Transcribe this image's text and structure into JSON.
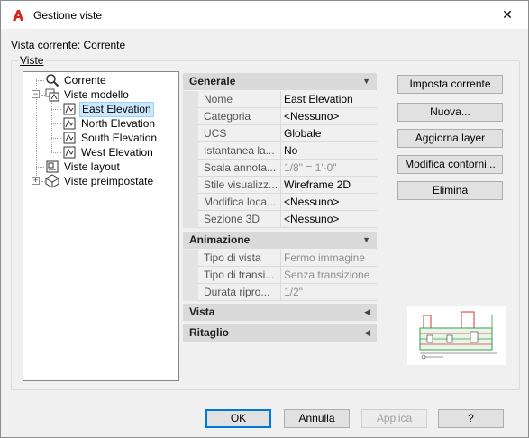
{
  "window": {
    "title": "Gestione viste",
    "close_symbol": "✕"
  },
  "current_view_label": "Vista corrente: Corrente",
  "group_label": "Viste",
  "tree": {
    "items": [
      {
        "label": "Corrente"
      },
      {
        "label": "Viste modello"
      },
      {
        "label": "East Elevation",
        "selected": true
      },
      {
        "label": "North Elevation"
      },
      {
        "label": "South Elevation"
      },
      {
        "label": "West Elevation"
      },
      {
        "label": "Viste layout"
      },
      {
        "label": "Viste preimpostate"
      }
    ]
  },
  "properties": {
    "sections": [
      {
        "title": "Generale",
        "expanded": true,
        "rows": [
          {
            "name": "Nome",
            "value": "East Elevation",
            "disabled": false
          },
          {
            "name": "Categoria",
            "value": "<Nessuno>",
            "disabled": false
          },
          {
            "name": "UCS",
            "value": "Globale",
            "disabled": false
          },
          {
            "name": "Istantanea la...",
            "value": "No",
            "disabled": false
          },
          {
            "name": "Scala annota...",
            "value": "1/8\" = 1'-0\"",
            "disabled": true
          },
          {
            "name": "Stile visualizz...",
            "value": "Wireframe 2D",
            "disabled": false
          },
          {
            "name": "Modifica loca...",
            "value": "<Nessuno>",
            "disabled": false
          },
          {
            "name": "Sezione 3D",
            "value": "<Nessuno>",
            "disabled": false
          }
        ]
      },
      {
        "title": "Animazione",
        "expanded": true,
        "rows": [
          {
            "name": "Tipo di vista",
            "value": "Fermo immagine",
            "disabled": true
          },
          {
            "name": "Tipo di transi...",
            "value": "Senza transizione",
            "disabled": true
          },
          {
            "name": "Durata ripro...",
            "value": "1/2\"",
            "disabled": true
          }
        ]
      },
      {
        "title": "Vista",
        "expanded": false,
        "rows": []
      },
      {
        "title": "Ritaglio",
        "expanded": false,
        "rows": []
      }
    ]
  },
  "buttons": {
    "set_current": "Imposta corrente",
    "new": "Nuova...",
    "update_layers": "Aggiorna layer",
    "edit_boundaries": "Modifica contorni...",
    "delete": "Elimina",
    "ok": "OK",
    "cancel": "Annulla",
    "apply": "Applica",
    "help": "?"
  },
  "colors": {
    "accent": "#0078d7",
    "app_icon": "#d9261c",
    "selection": "#cce8ff"
  }
}
